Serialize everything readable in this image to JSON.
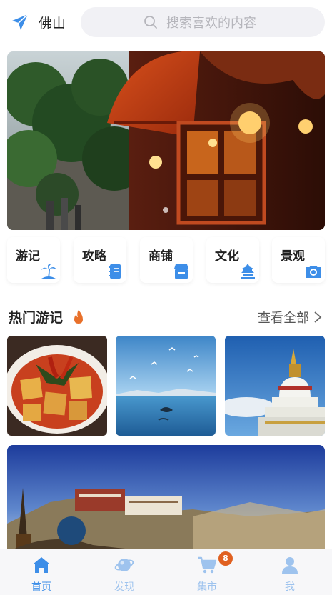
{
  "header": {
    "location": "佛山",
    "search_placeholder": "搜索喜欢的内容"
  },
  "categories": [
    {
      "label": "游记",
      "icon": "palm-tree-icon"
    },
    {
      "label": "攻略",
      "icon": "notebook-icon"
    },
    {
      "label": "商铺",
      "icon": "store-icon"
    },
    {
      "label": "文化",
      "icon": "temple-icon"
    },
    {
      "label": "景观",
      "icon": "camera-icon"
    }
  ],
  "hot": {
    "title": "热门游记",
    "more": "查看全部"
  },
  "tabs": [
    {
      "label": "首页",
      "icon": "home-icon",
      "active": true
    },
    {
      "label": "发现",
      "icon": "planet-icon",
      "active": false
    },
    {
      "label": "集市",
      "icon": "cart-icon",
      "active": false,
      "badge": "8"
    },
    {
      "label": "我",
      "icon": "user-icon",
      "active": false
    }
  ],
  "colors": {
    "accent": "#3d8ee8",
    "tab_inactive": "#9ec3ee",
    "badge": "#e06020",
    "fire": "#e8702a"
  }
}
